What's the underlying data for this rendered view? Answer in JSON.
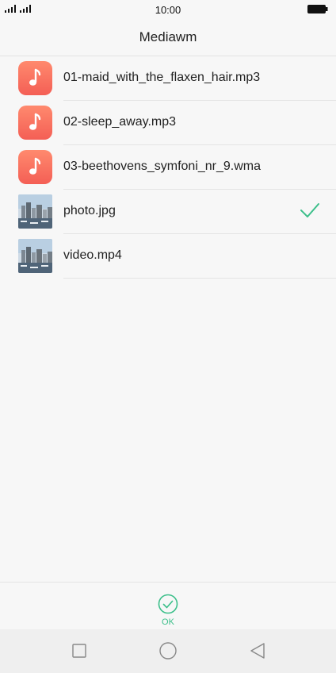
{
  "status_bar": {
    "time": "10:00"
  },
  "header": {
    "title": "Mediawm"
  },
  "files": [
    {
      "name": "01-maid_with_the_flaxen_hair.mp3",
      "type": "music",
      "selected": false
    },
    {
      "name": "02-sleep_away.mp3",
      "type": "music",
      "selected": false
    },
    {
      "name": "03-beethovens_symfoni_nr_9.wma",
      "type": "music",
      "selected": false
    },
    {
      "name": "photo.jpg",
      "type": "image",
      "selected": true
    },
    {
      "name": "video.mp4",
      "type": "video",
      "selected": false
    }
  ],
  "footer": {
    "ok_label": "OK"
  },
  "colors": {
    "accent": "#3cbf8a",
    "music_icon_top": "#ff8a6e",
    "music_icon_bottom": "#f45f55"
  },
  "icons": {
    "signal": "signal-icon",
    "battery": "battery-icon",
    "music": "music-note-icon",
    "check": "checkmark-icon",
    "ok": "check-circle-icon",
    "nav_recent": "square-icon",
    "nav_home": "circle-icon",
    "nav_back": "triangle-back-icon"
  }
}
